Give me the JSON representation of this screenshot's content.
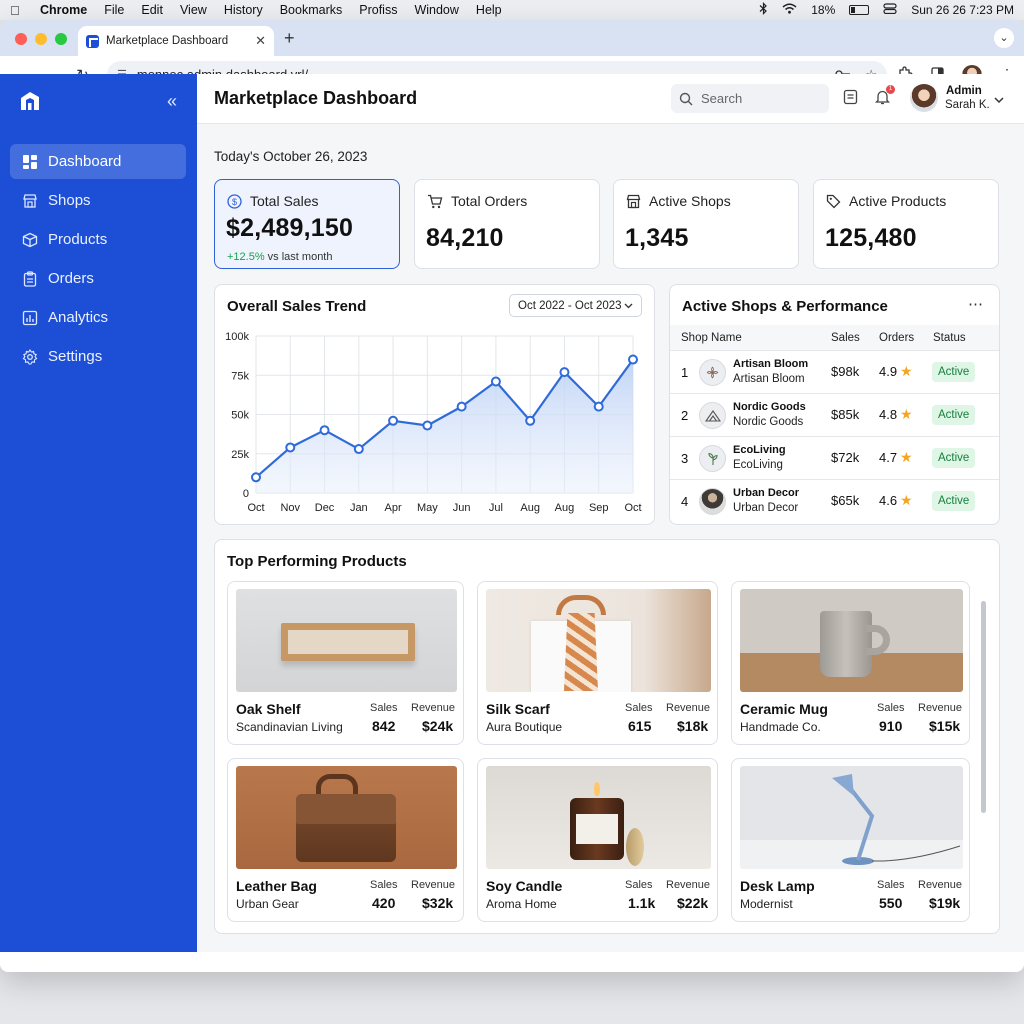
{
  "menubar": {
    "app": "Chrome",
    "items": [
      "File",
      "Edit",
      "View",
      "History",
      "Bookmarks",
      "Profiss",
      "Window",
      "Help"
    ],
    "battery": "18%",
    "datetime": "Sun 26 26  7:23 PM"
  },
  "browser": {
    "tab_title": "Marketplace Dashboard",
    "url": "monnec.admin.dashboard.vrl/"
  },
  "sidebar": {
    "items": [
      {
        "label": "Dashboard",
        "icon": "grid-icon"
      },
      {
        "label": "Shops",
        "icon": "store-icon"
      },
      {
        "label": "Products",
        "icon": "box-icon"
      },
      {
        "label": "Orders",
        "icon": "clipboard-icon"
      },
      {
        "label": "Analytics",
        "icon": "bar-chart-icon"
      },
      {
        "label": "Settings",
        "icon": "gear-icon"
      }
    ],
    "accent": "#1c4fd6"
  },
  "header": {
    "title": "Marketplace Dashboard",
    "search_placeholder": "Search",
    "notification_count": "1",
    "user_role": "Admin",
    "user_name": "Sarah K."
  },
  "date_line": "Today's October 26, 2023",
  "kpis": [
    {
      "label": "Total Sales",
      "value": "$2,489,150",
      "delta": "+12.5%",
      "delta_suffix": " vs last month"
    },
    {
      "label": "Total Orders",
      "value": "84,210"
    },
    {
      "label": "Active Shops",
      "value": "1,345"
    },
    {
      "label": "Active Products",
      "value": "125,480"
    }
  ],
  "sales_trend": {
    "title": "Overall Sales Trend",
    "range": "Oct 2022 - Oct 2023"
  },
  "chart_data": {
    "type": "area",
    "categories": [
      "Oct",
      "Nov",
      "Dec",
      "Jan",
      "Apr",
      "May",
      "Jun",
      "Jul",
      "Aug",
      "Aug",
      "Sep",
      "Oct"
    ],
    "values": [
      10000,
      29000,
      40000,
      28000,
      46000,
      43000,
      55000,
      71000,
      46000,
      77000,
      55000,
      85000
    ],
    "yticks": [
      "0",
      "25k",
      "50k",
      "75k",
      "100k"
    ],
    "ylim": [
      0,
      100000
    ],
    "grid": true,
    "line_color": "#2f6bd8"
  },
  "shops_table": {
    "title": "Active Shops & Performance",
    "columns": [
      "Shop Name",
      "Sales",
      "Orders",
      "Status"
    ],
    "rows": [
      {
        "rank": "1",
        "name": "Artisan Bloom",
        "sub": "Artisan Bloom",
        "sales": "$98k",
        "orders": "4.9",
        "status": "Active"
      },
      {
        "rank": "2",
        "name": "Nordic Goods",
        "sub": "Nordic Goods",
        "sales": "$85k",
        "orders": "4.8",
        "status": "Active"
      },
      {
        "rank": "3",
        "name": "EcoLiving",
        "sub": "EcoLiving",
        "sales": "$72k",
        "orders": "4.7",
        "status": "Active"
      },
      {
        "rank": "4",
        "name": "Urban Decor",
        "sub": "Urban Decor",
        "sales": "$65k",
        "orders": "4.6",
        "status": "Active"
      }
    ]
  },
  "products": {
    "title": "Top Performing Products",
    "sales_label": "Sales",
    "revenue_label": "Revenue",
    "items": [
      {
        "name": "Oak Shelf",
        "shop": "Scandinavian Living",
        "sales": "842",
        "revenue": "$24k"
      },
      {
        "name": "Silk Scarf",
        "shop": "Aura Boutique",
        "sales": "615",
        "revenue": "$18k"
      },
      {
        "name": "Ceramic Mug",
        "shop": "Handmade Co.",
        "sales": "910",
        "revenue": "$15k"
      },
      {
        "name": "Leather Bag",
        "shop": "Urban Gear",
        "sales": "420",
        "revenue": "$32k"
      },
      {
        "name": "Soy Candle",
        "shop": "Aroma Home",
        "sales": "1.1k",
        "revenue": "$22k"
      },
      {
        "name": "Desk Lamp",
        "shop": "Modernist",
        "sales": "550",
        "revenue": "$19k"
      }
    ]
  }
}
